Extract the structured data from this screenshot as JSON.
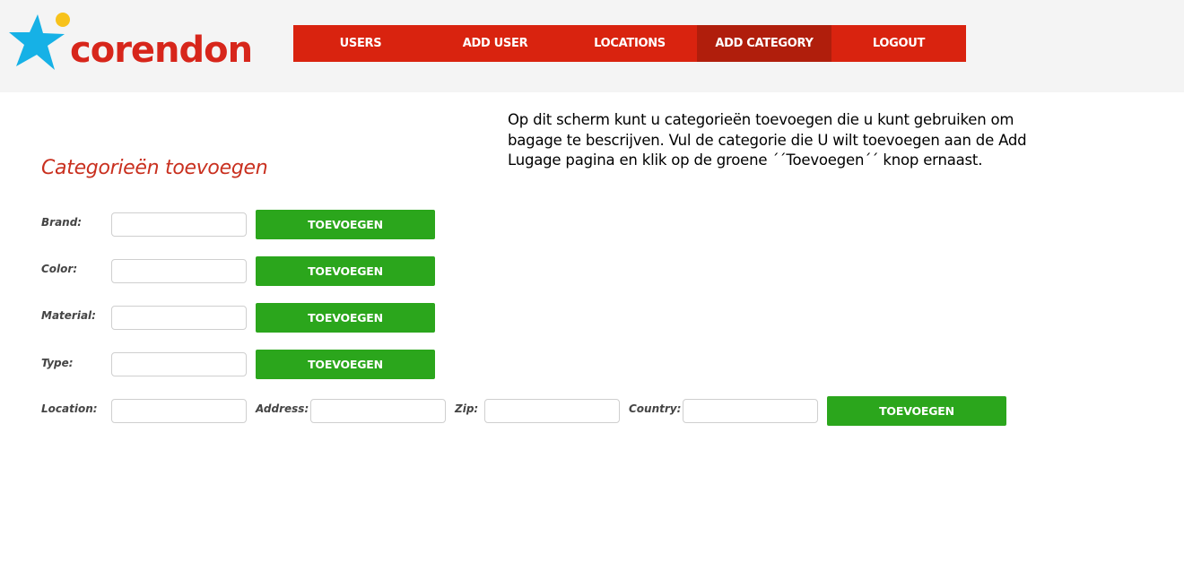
{
  "brand": {
    "name": "corendon",
    "colors": {
      "primary_red": "#d9230f",
      "active_red": "#b01e0c",
      "star_cyan": "#16b1e6",
      "sun_yellow": "#f7c21b",
      "button_green": "#2ba61c",
      "title_red": "#c9301f"
    },
    "logo_icons": [
      "star-icon",
      "sun-icon"
    ]
  },
  "nav": {
    "items": [
      {
        "label": "USERS",
        "active": false
      },
      {
        "label": "ADD USER",
        "active": false
      },
      {
        "label": "LOCATIONS",
        "active": false
      },
      {
        "label": "ADD CATEGORY",
        "active": true
      },
      {
        "label": "LOGOUT",
        "active": false
      }
    ]
  },
  "intro": {
    "lines": [
      "Op dit scherm kunt u categorieën toevoegen die u kunt gebruiken om",
      "bagage te bescrijven. Vul de categorie die U wilt toevoegen aan de Add",
      "Lugage pagina en klik op de groene ´´Toevoegen´´ knop ernaast."
    ]
  },
  "page_title": "Categorieën toevoegen",
  "form": {
    "rows": [
      {
        "label": "Brand:",
        "value": "",
        "placeholder": "",
        "button": "TOEVOEGEN"
      },
      {
        "label": "Color:",
        "value": "",
        "placeholder": "",
        "button": "TOEVOEGEN"
      },
      {
        "label": "Material:",
        "value": "",
        "placeholder": "",
        "button": "TOEVOEGEN"
      },
      {
        "label": "Type:",
        "value": "",
        "placeholder": "",
        "button": "TOEVOEGEN"
      }
    ],
    "location_row": {
      "location_label": "Location:",
      "location_value": "",
      "address_label": "Address:",
      "address_value": "",
      "zip_label": "Zip:",
      "zip_value": "",
      "country_label": "Country:",
      "country_value": "",
      "button": "TOEVOEGEN"
    }
  }
}
